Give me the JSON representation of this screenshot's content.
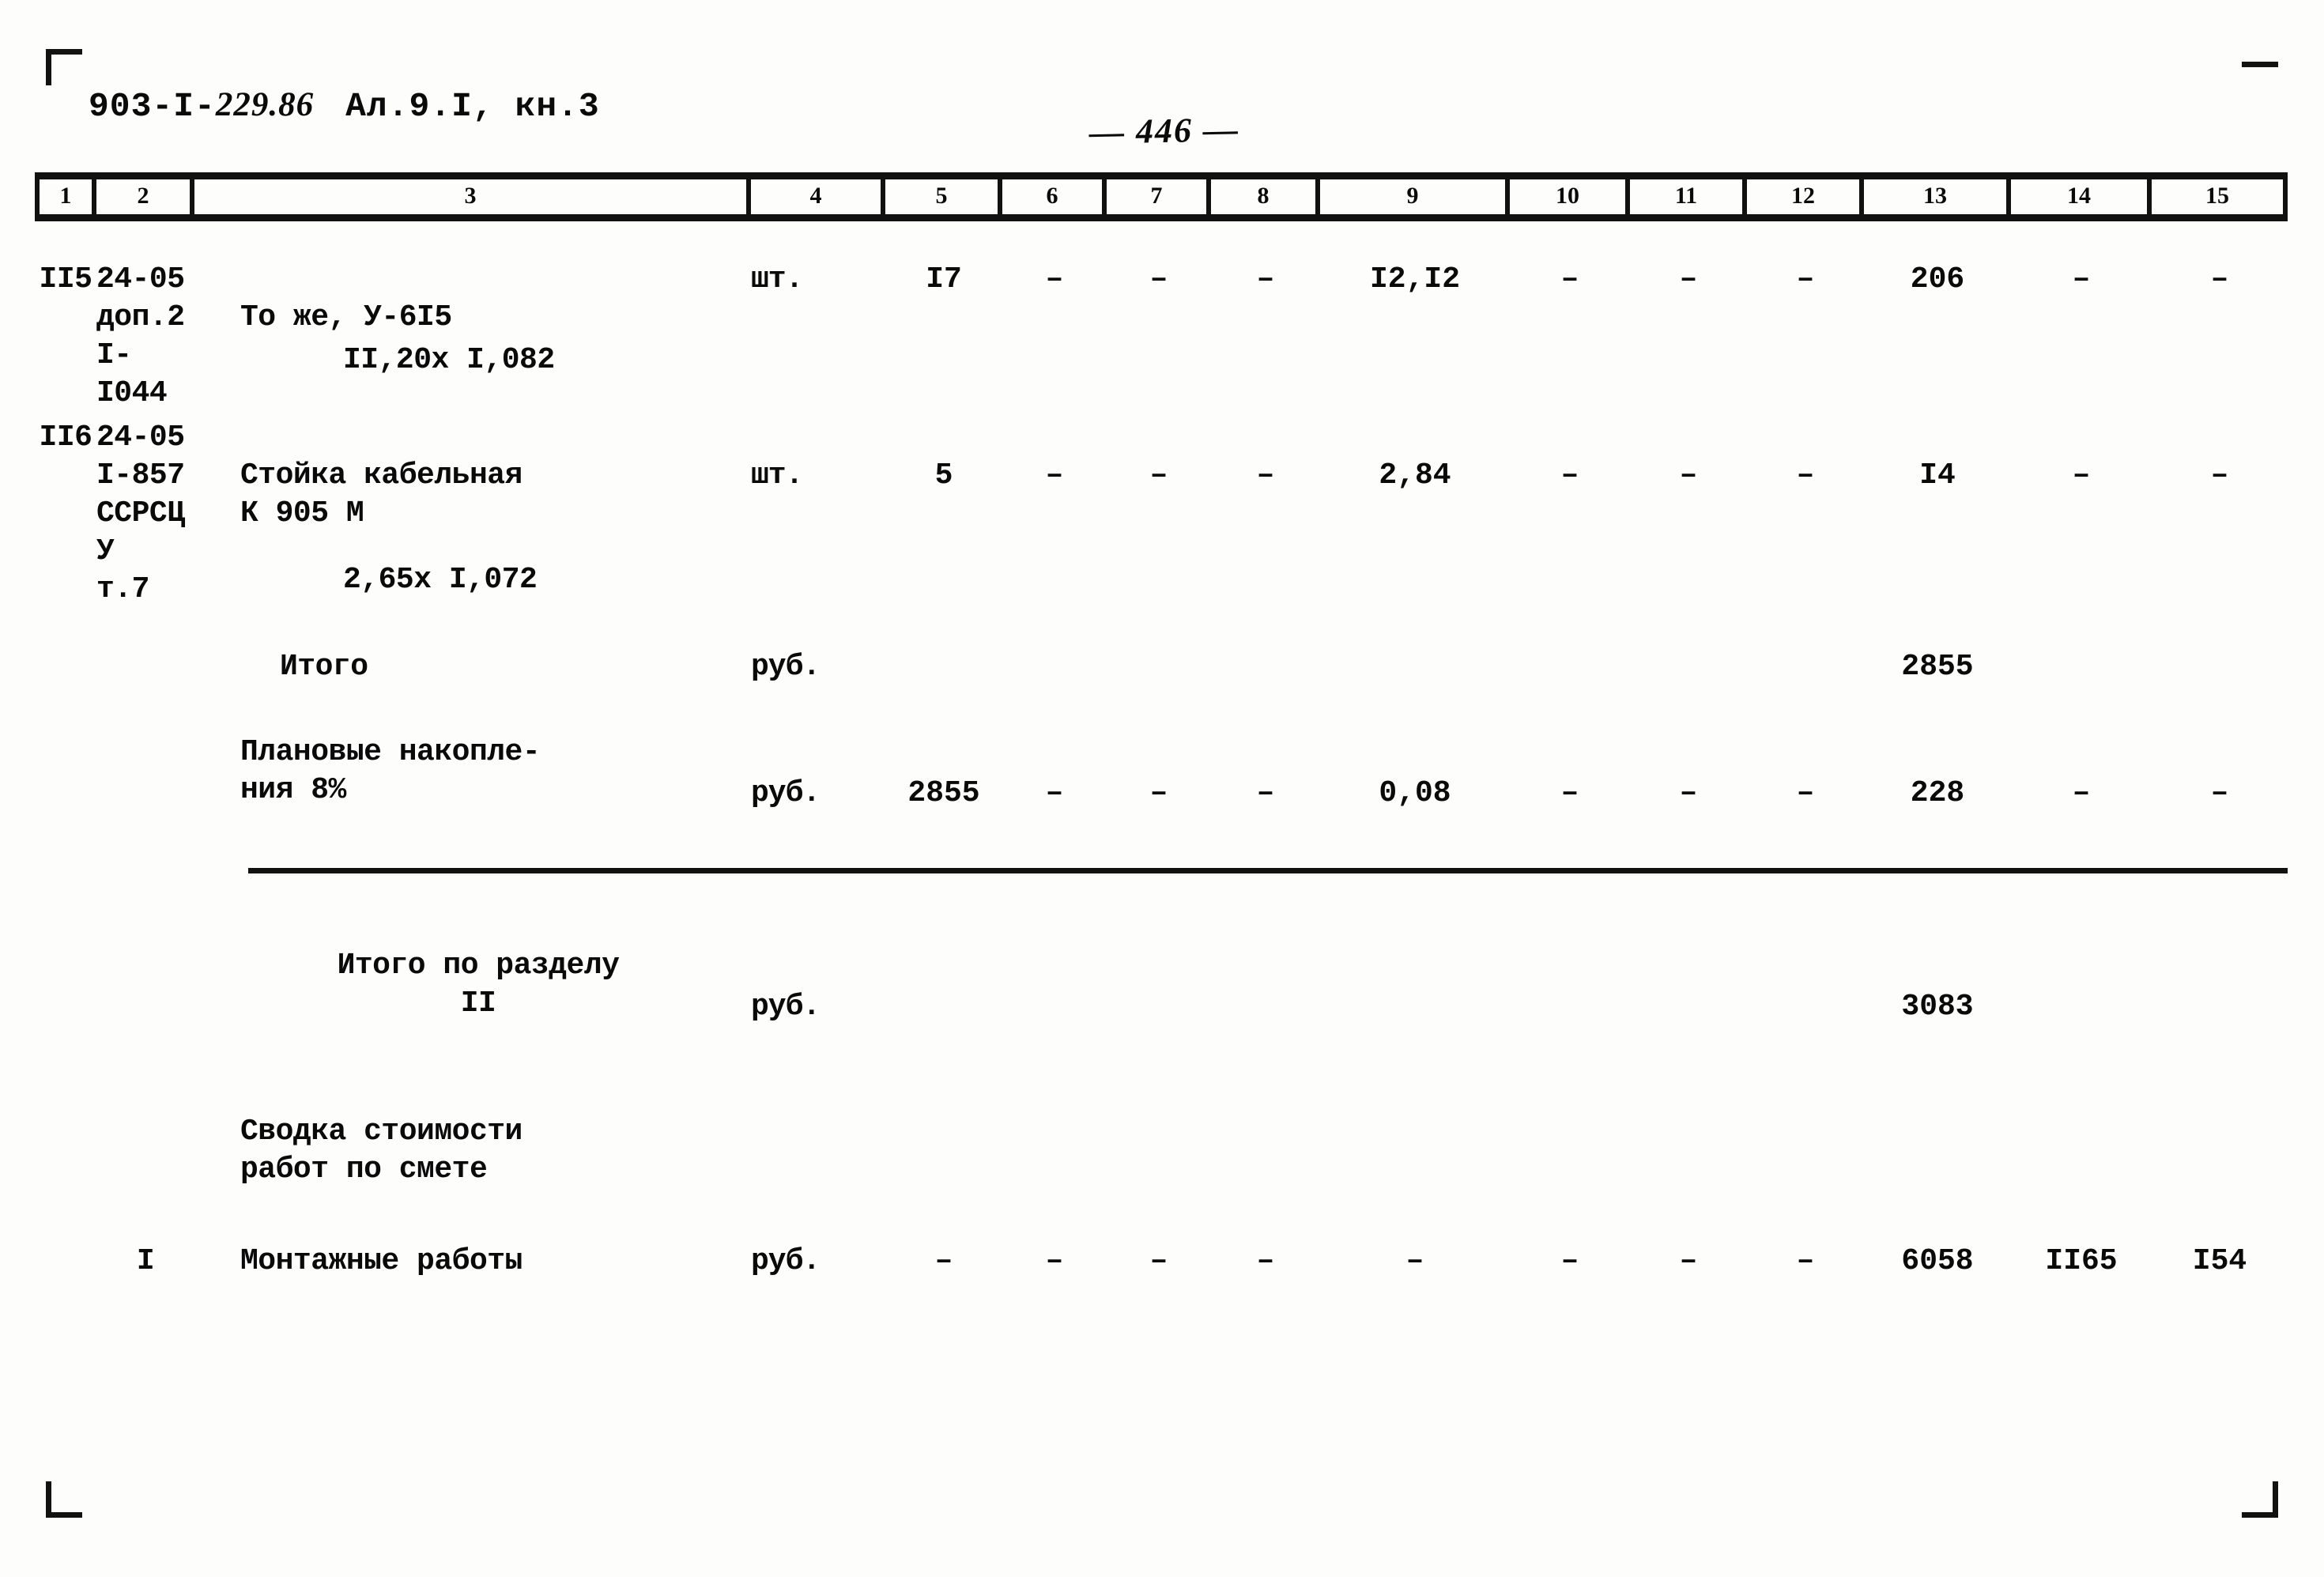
{
  "header": {
    "doc_code_prefix": "903-I-",
    "doc_code_hand": "229.86",
    "album": "Ал.9.I, кн.3",
    "page_number": "— 446 —"
  },
  "table": {
    "column_headers": [
      "1",
      "2",
      "3",
      "4",
      "5",
      "6",
      "7",
      "8",
      "9",
      "10",
      "11",
      "12",
      "13",
      "14",
      "15"
    ],
    "rows": [
      {
        "kind": "item",
        "c1": "II5",
        "c2": "24-05\nдоп.2\nI-I044",
        "c3": "То же, У-6I5",
        "c3_sub": "II,20х I,082",
        "c4": "шт.",
        "c5": "I7",
        "c6": "–",
        "c7": "–",
        "c8": "–",
        "c9": "I2,I2",
        "c10": "–",
        "c11": "–",
        "c12": "–",
        "c13": "206",
        "c14": "–",
        "c15": "–"
      },
      {
        "kind": "item",
        "c1": "II6",
        "c2": "24-05\nI-857\nССРСЦ\nУ\nт.7",
        "c3": "Стойка кабельная\nК 905 М",
        "c3_sub": "2,65х I,072",
        "c4": "шт.",
        "c5": "5",
        "c6": "–",
        "c7": "–",
        "c8": "–",
        "c9": "2,84",
        "c10": "–",
        "c11": "–",
        "c12": "–",
        "c13": "I4",
        "c14": "–",
        "c15": "–"
      },
      {
        "kind": "total",
        "c1": "",
        "c2": "",
        "c3": "Итого",
        "c4": "руб.",
        "c5": "",
        "c6": "",
        "c7": "",
        "c8": "",
        "c9": "",
        "c10": "",
        "c11": "",
        "c12": "",
        "c13": "2855",
        "c14": "",
        "c15": ""
      },
      {
        "kind": "total",
        "c1": "",
        "c2": "",
        "c3": "Плановые накопле-\nния 8%",
        "c4": "руб.",
        "c5": "2855",
        "c6": "–",
        "c7": "–",
        "c8": "–",
        "c9": "0,08",
        "c10": "–",
        "c11": "–",
        "c12": "–",
        "c13": "228",
        "c14": "–",
        "c15": "–"
      },
      {
        "kind": "section-total",
        "c1": "",
        "c2": "",
        "c3": "Итого по разделу\nII",
        "c4": "руб.",
        "c5": "",
        "c6": "",
        "c7": "",
        "c8": "",
        "c9": "",
        "c10": "",
        "c11": "",
        "c12": "",
        "c13": "3083",
        "c14": "",
        "c15": ""
      },
      {
        "kind": "heading",
        "c1": "",
        "c2": "",
        "c3": "Сводка стоимости\nработ по смете",
        "c4": "",
        "c5": "",
        "c6": "",
        "c7": "",
        "c8": "",
        "c9": "",
        "c10": "",
        "c11": "",
        "c12": "",
        "c13": "",
        "c14": "",
        "c15": ""
      },
      {
        "kind": "summary",
        "c1": "",
        "c2": "I",
        "c3": "Монтажные работы",
        "c4": "руб.",
        "c5": "–",
        "c6": "–",
        "c7": "–",
        "c8": "–",
        "c9": "–",
        "c10": "–",
        "c11": "–",
        "c12": "–",
        "c13": "6058",
        "c14": "II65",
        "c15": "I54"
      }
    ]
  }
}
